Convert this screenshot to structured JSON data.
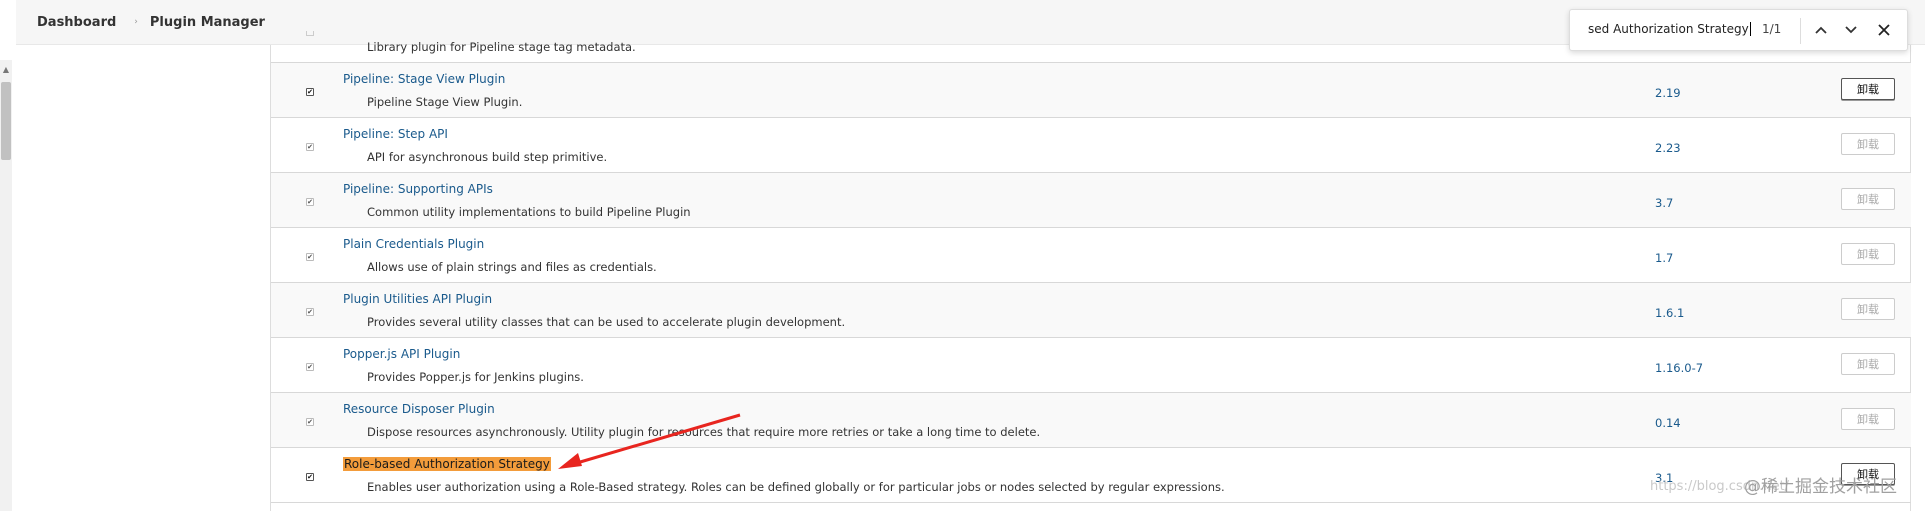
{
  "breadcrumb": {
    "items": [
      "Dashboard",
      "Plugin Manager"
    ],
    "separator": "›"
  },
  "find_bar": {
    "query": "sed Authorization Strategy",
    "count": "1/1",
    "prev_icon": "chevron-up-icon",
    "next_icon": "chevron-down-icon",
    "close_icon": "close-icon"
  },
  "top_partial": {
    "description": "Library plugin for Pipeline stage tag metadata."
  },
  "plugins": [
    {
      "name": "Pipeline: Stage View Plugin",
      "description": "Pipeline Stage View Plugin.",
      "version": "2.19",
      "uninstall_label": "卸载",
      "enabled": true,
      "highlight": false
    },
    {
      "name": "Pipeline: Step API",
      "description": "API for asynchronous build step primitive.",
      "version": "2.23",
      "uninstall_label": "卸载",
      "enabled": false,
      "highlight": false
    },
    {
      "name": "Pipeline: Supporting APIs",
      "description": "Common utility implementations to build Pipeline Plugin",
      "version": "3.7",
      "uninstall_label": "卸载",
      "enabled": false,
      "highlight": false
    },
    {
      "name": "Plain Credentials Plugin",
      "description": "Allows use of plain strings and files as credentials.",
      "version": "1.7",
      "uninstall_label": "卸载",
      "enabled": false,
      "highlight": false
    },
    {
      "name": "Plugin Utilities API Plugin",
      "description": "Provides several utility classes that can be used to accelerate plugin development.",
      "version": "1.6.1",
      "uninstall_label": "卸载",
      "enabled": false,
      "highlight": false
    },
    {
      "name": "Popper.js API Plugin",
      "description": "Provides Popper.js for Jenkins plugins.",
      "version": "1.16.0-7",
      "uninstall_label": "卸载",
      "enabled": false,
      "highlight": false
    },
    {
      "name": "Resource Disposer Plugin",
      "description": "Dispose resources asynchronously. Utility plugin for resources that require more retries or take a long time to delete.",
      "version": "0.14",
      "uninstall_label": "卸载",
      "enabled": false,
      "highlight": false
    },
    {
      "name": "Role-based Authorization Strategy",
      "description": "Enables user authorization using a Role-Based strategy. Roles can be defined globally or for particular jobs or nodes selected by regular expressions.",
      "version": "3.1",
      "uninstall_label": "卸载",
      "enabled": true,
      "highlight": true
    }
  ],
  "watermark": {
    "url_text": "https://blog.csdn.net/",
    "stamp_text": "@稀土掘金技术社区"
  },
  "colors": {
    "link": "#1a5a8c",
    "highlight": "#f39c3b",
    "arrow": "#e8251f"
  }
}
